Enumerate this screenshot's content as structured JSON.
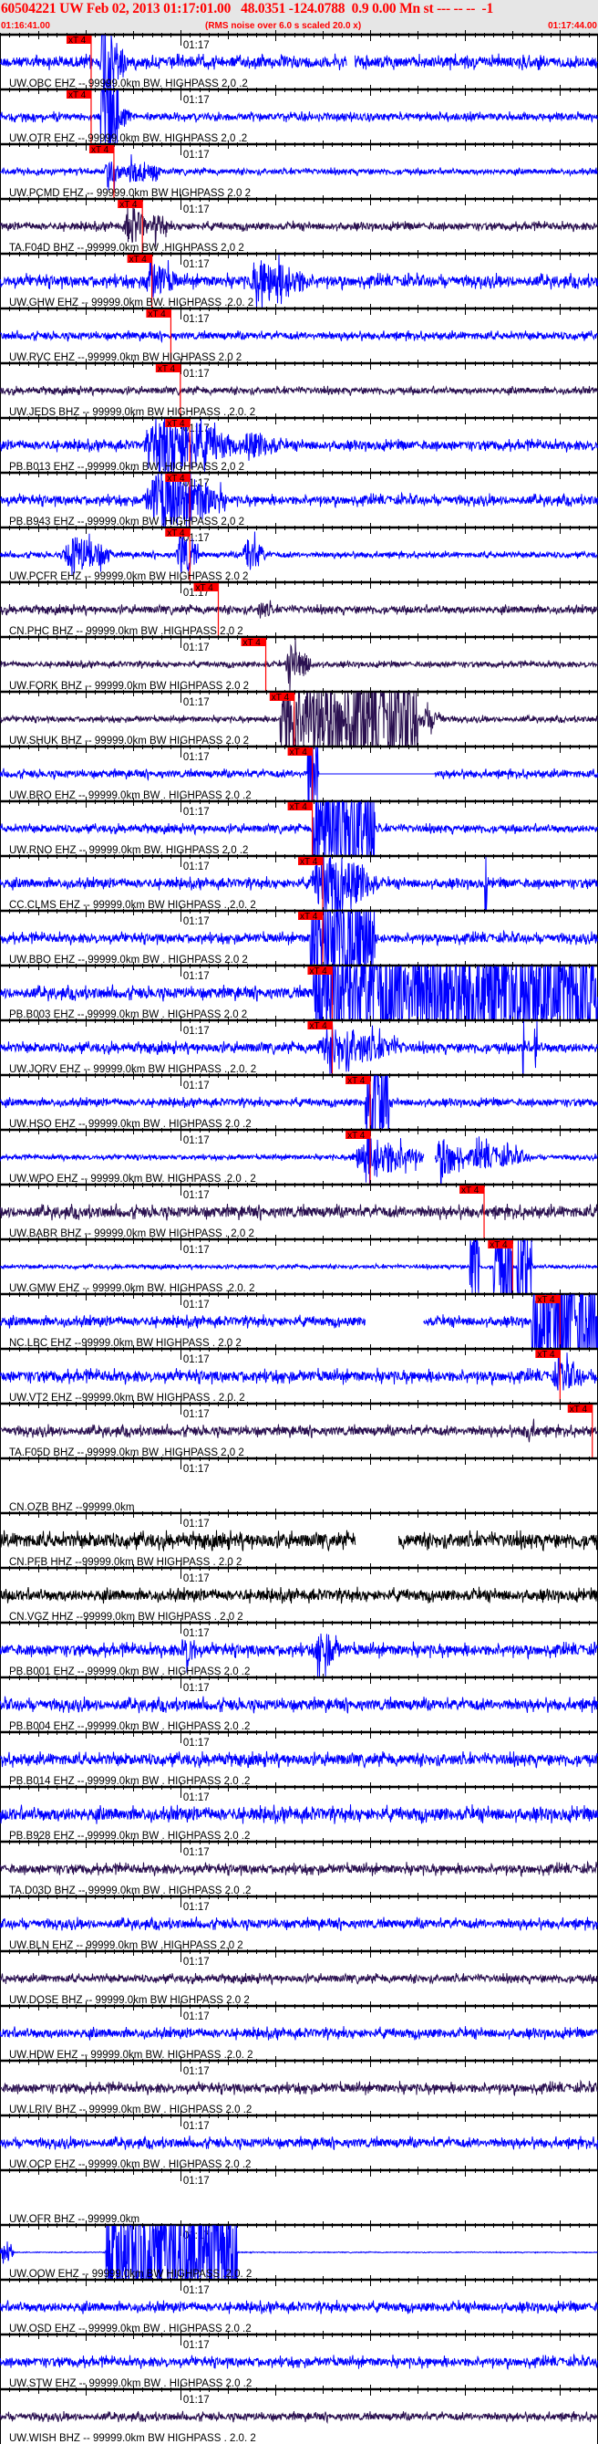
{
  "header": {
    "title": "60504221 UW Feb 02, 2013 01:17:01.00   48.0351 -124.0788  0.9 0.00 Mn st --- -- --  -1",
    "start_time": "01:16:41.00",
    "end_time": "01:17:44.00",
    "rms_note": "(RMS noise over 6.0 s scaled 20.0 x)"
  },
  "colors": {
    "title": "#ff0000",
    "blue": "#0000ff",
    "purple": "#2a1050",
    "black": "#000000",
    "pick": "#ff0000"
  },
  "chart_data": {
    "type": "line",
    "title": "60504221 UW Feb 02, 2013 01:17:01.00",
    "x_range_s": [
      0,
      63
    ],
    "x_start": "01:16:41.00",
    "tick_label": "01:17",
    "tick_label_time_s": 19,
    "pick_label": "xT 4",
    "traces": [
      {
        "label": "UW.OBC EHZ -- 99999.0km BW. HIGHPASS  2.0 .2",
        "color": "blue",
        "noise": 0.12,
        "pick_s": 9.6,
        "events": [
          [
            10.7,
            12.0,
            1.3
          ],
          [
            12.0,
            13.5,
            0.6
          ]
        ],
        "gaps": [
          [
            36.5,
            37.4
          ]
        ]
      },
      {
        "label": "UW.OTR EHZ -- 99999.0km BW. HIGHPASS  2.0 .2",
        "color": "blue",
        "noise": 0.08,
        "pick_s": 9.6,
        "events": [
          [
            10.6,
            12.5,
            1.2
          ],
          [
            12.5,
            14,
            0.3
          ]
        ]
      },
      {
        "label": "UW.PCMD EHZ -- 99999.0km BW HIGHPASS  2.0  2",
        "color": "blue",
        "noise": 0.06,
        "pick_s": 12.0,
        "events": [
          [
            11,
            13,
            0.4
          ],
          [
            13,
            17,
            0.3
          ]
        ]
      },
      {
        "label": "TA.F04D BHZ -- 99999.0km BW .HIGHPASS  2.0  2",
        "color": "purple",
        "noise": 0.08,
        "pick_s": 15.0,
        "events": [
          [
            13,
            16,
            0.5
          ],
          [
            16,
            18,
            0.3
          ]
        ]
      },
      {
        "label": "UW.GHW EHZ -- 99999.0km BW. HIGHPASS .2.0. 2",
        "color": "blue",
        "noise": 0.12,
        "pick_s": 16.0,
        "events": [
          [
            15,
            19,
            0.5
          ],
          [
            26,
            33,
            0.6
          ]
        ]
      },
      {
        "label": "UW.RVC EHZ -- 99999.0km BW  HIGHPASS  2.0  2",
        "color": "blue",
        "noise": 0.08,
        "pick_s": 18.0,
        "events": []
      },
      {
        "label": "UW.JEDS BHZ -- 99999.0km BW  HIGHPASS . 2.0. 2",
        "color": "purple",
        "noise": 0.07,
        "pick_s": 19.0,
        "events": []
      },
      {
        "label": "PB.B013 EHZ -- 99999.0km BW .HIGHPASS  2.0  2",
        "color": "blue",
        "noise": 0.1,
        "pick_s": 20.0,
        "events": [
          [
            15,
            25,
            0.9
          ],
          [
            25,
            30,
            0.35
          ]
        ]
      },
      {
        "label": "PB.B943 EHZ -- 99999.0km BW .HIGHPASS  2.0  2",
        "color": "blue",
        "noise": 0.1,
        "pick_s": 20.0,
        "events": [
          [
            15,
            24,
            0.9
          ]
        ]
      },
      {
        "label": "UW.PCFR EHZ -- 99999.0km BW  HIGHPASS  2.0  2",
        "color": "blue",
        "noise": 0.06,
        "pick_s": 20.0,
        "events": [
          [
            6.5,
            12,
            0.5
          ],
          [
            18.5,
            21,
            0.6
          ],
          [
            25.5,
            28,
            0.5
          ]
        ]
      },
      {
        "label": "CN.PHC BHZ -- 99999.0km BW .HIGHPASS  2.0  2",
        "color": "purple",
        "noise": 0.08,
        "pick_s": 23.0,
        "events": [
          [
            27,
            29,
            0.2
          ]
        ]
      },
      {
        "label": "UW.FORK BHZ -- 99999.0km BW  HIGHPASS  2.0  2",
        "color": "purple",
        "noise": 0.06,
        "pick_s": 28.0,
        "events": [
          [
            30,
            33,
            0.5
          ]
        ]
      },
      {
        "label": "UW.SHUK BHZ -- 99999.0km BW  HIGHPASS  2.0  2",
        "color": "purple",
        "noise": 0.06,
        "pick_s": 31.0,
        "events": [
          [
            29.5,
            44,
            1.0
          ],
          [
            44,
            47,
            0.3
          ]
        ]
      },
      {
        "label": "UW.BRO EHZ -- 99999.0km BW . HIGHPASS  2.0 .2",
        "color": "blue",
        "noise": 0.08,
        "pick_s": 32.9,
        "events": [
          [
            32.4,
            33.5,
            1.3
          ]
        ],
        "flat": [
          [
            33.6,
            45.8
          ]
        ]
      },
      {
        "label": "UW.RNO EHZ -- 99999.0km BW. HIGHPASS  2.0 .2",
        "color": "blue",
        "noise": 0.08,
        "pick_s": 32.9,
        "events": [
          [
            32.9,
            39.5,
            1.6
          ]
        ]
      },
      {
        "label": "CC.CLMS EHZ -- 99999.0km BW  HIGHPASS . 2.0. 2",
        "color": "blue",
        "noise": 0.1,
        "pick_s": 34.0,
        "events": [
          [
            32.5,
            40,
            0.9
          ],
          [
            51,
            51.3,
            1.3
          ]
        ]
      },
      {
        "label": "UW.BBO EHZ -- 99999.0km BW . HIGHPASS  2.0  2",
        "color": "blue",
        "noise": 0.1,
        "pick_s": 34.0,
        "events": [
          [
            32.7,
            39.5,
            1.5
          ]
        ]
      },
      {
        "label": "PB.B003 EHZ -- 99999.0km BW . HIGHPASS  2.0  2",
        "color": "blue",
        "noise": 0.12,
        "pick_s": 35.0,
        "events": [
          [
            33,
            63,
            1.3
          ]
        ]
      },
      {
        "label": "UW.JORV EHZ -- 99999.0km BW  HIGHPASS . 2.0. 2",
        "color": "blue",
        "noise": 0.1,
        "pick_s": 35.0,
        "events": [
          [
            33,
            43,
            0.5
          ],
          [
            55,
            55.4,
            1.0
          ],
          [
            56.3,
            56.6,
            1.0
          ]
        ]
      },
      {
        "label": "UW.HSO EHZ -- 99999.0km BW . HIGHPASS  2.0 .2",
        "color": "blue",
        "noise": 0.08,
        "pick_s": 39.0,
        "events": [
          [
            38.5,
            41,
            1.6
          ]
        ]
      },
      {
        "label": "UW.WPO EHZ -- 99999.0km BW. HIGHPASS .2.0 . 2",
        "color": "blue",
        "noise": 0.05,
        "pick_s": 39.0,
        "events": [
          [
            37,
            44.7,
            0.55
          ],
          [
            45.8,
            49,
            0.6
          ],
          [
            49,
            56,
            0.3
          ]
        ],
        "gaps": [
          [
            44.7,
            45.8
          ]
        ]
      },
      {
        "label": "UW.BABR BHZ -- 99999.0km BW  HIGHPASS . 2.0  2",
        "color": "purple",
        "noise": 0.12,
        "pick_s": 51.0,
        "events": []
      },
      {
        "label": "UW.GMW EHZ -- 99999.0km BW. HIGHPASS .2.0. 2",
        "color": "blue",
        "noise": 0.04,
        "pick_s": 54.0,
        "events": [
          [
            49.5,
            50.5,
            1.3
          ],
          [
            52,
            54,
            1.2
          ],
          [
            54.5,
            56,
            1.3
          ]
        ]
      },
      {
        "label": "NC.LBC EHZ --99999.0km BW  HIGHPASS . 2.0  2",
        "color": "blue",
        "noise": 0.1,
        "pick_s": 59.0,
        "events": [
          [
            56,
            63,
            1.5
          ]
        ],
        "gaps": [
          [
            38.5,
            44.6
          ]
        ]
      },
      {
        "label": "UW.VT2 EHZ --99999.0km BW  HIGHPASS . 2.0. 2",
        "color": "blue",
        "noise": 0.12,
        "pick_s": 59.0,
        "events": [
          [
            58,
            62,
            0.4
          ]
        ]
      },
      {
        "label": "TA.F05D BHZ -- 99999.0km BW .HIGHPASS  2.0  2",
        "color": "purple",
        "noise": 0.1,
        "pick_s": 62.4,
        "events": [
          [
            55,
            57,
            0.25
          ]
        ]
      },
      {
        "label": "CN.OZB BHZ --99999.0km",
        "color": "none",
        "noise": 0,
        "events": []
      },
      {
        "label": "CN.PFB HHZ --99999.0km BW  HIGHPASS . 2.0  2",
        "color": "black",
        "noise": 0.15,
        "events": [],
        "gaps": [
          [
            37.5,
            42
          ]
        ]
      },
      {
        "label": "CN.VGZ HHZ --99999.0km BW  HIGHPASS . 2.0  2",
        "color": "black",
        "noise": 0.12,
        "events": []
      },
      {
        "label": "PB.B001 EHZ -- 99999.0km BW . HIGHPASS  2.0 .2",
        "color": "blue",
        "noise": 0.12,
        "events": [
          [
            19,
            21,
            0.5
          ],
          [
            33,
            36,
            0.6
          ]
        ]
      },
      {
        "label": "PB.B004 EHZ -- 99999.0km BW . HIGHPASS  2.0 .2",
        "color": "blue",
        "noise": 0.12,
        "events": []
      },
      {
        "label": "PB.B014 EHZ -- 99999.0km BW . HIGHPASS  2.0 .2",
        "color": "blue",
        "noise": 0.12,
        "events": []
      },
      {
        "label": "PB.B928 EHZ -- 99999.0km BW . HIGHPASS  2.0 .2",
        "color": "blue",
        "noise": 0.14,
        "events": []
      },
      {
        "label": "TA.D03D BHZ -- 99999.0km BW . HIGHPASS  2.0 .2",
        "color": "purple",
        "noise": 0.1,
        "events": []
      },
      {
        "label": "UW.BLN EHZ -- 99999.0km BW .HIGHPASS  2.0  2",
        "color": "blue",
        "noise": 0.1,
        "events": []
      },
      {
        "label": "UW.DOSE BHZ -- 99999.0km BW  HIGHPASS  2.0  2",
        "color": "purple",
        "noise": 0.08,
        "events": []
      },
      {
        "label": "UW.HDW EHZ -- 99999.0km BW. HIGHPASS .2.0. 2",
        "color": "blue",
        "noise": 0.1,
        "events": []
      },
      {
        "label": "UW.LRIV BHZ -- 99999.0km BW . HIGHPASS  2.0 .2",
        "color": "purple",
        "noise": 0.1,
        "events": []
      },
      {
        "label": "UW.OCP EHZ -- 99999.0km BW . HIGHPASS  2.0 .2",
        "color": "blue",
        "noise": 0.1,
        "events": []
      },
      {
        "label": "UW.OFR BHZ -- 99999.0km",
        "color": "none",
        "noise": 0,
        "events": []
      },
      {
        "label": "UW.OOW EHZ -- 99999.0km BW  HIGHPASS .2.0. 2",
        "color": "blue",
        "noise": 0.01,
        "events": [
          [
            0,
            1.5,
            0.3
          ],
          [
            11.1,
            25,
            1.6
          ]
        ]
      },
      {
        "label": "UW.OSD EHZ -- 99999.0km BW . HIGHPASS  2.0 .2",
        "color": "blue",
        "noise": 0.1,
        "events": []
      },
      {
        "label": "UW.STW EHZ -- 99999.0km BW . HIGHPASS  2.0 .2",
        "color": "blue",
        "noise": 0.1,
        "events": []
      },
      {
        "label": "UW.WISH BHZ -- 99999.0km BW  HIGHPASS . 2.0. 2",
        "color": "purple",
        "noise": 0.08,
        "events": []
      }
    ]
  }
}
